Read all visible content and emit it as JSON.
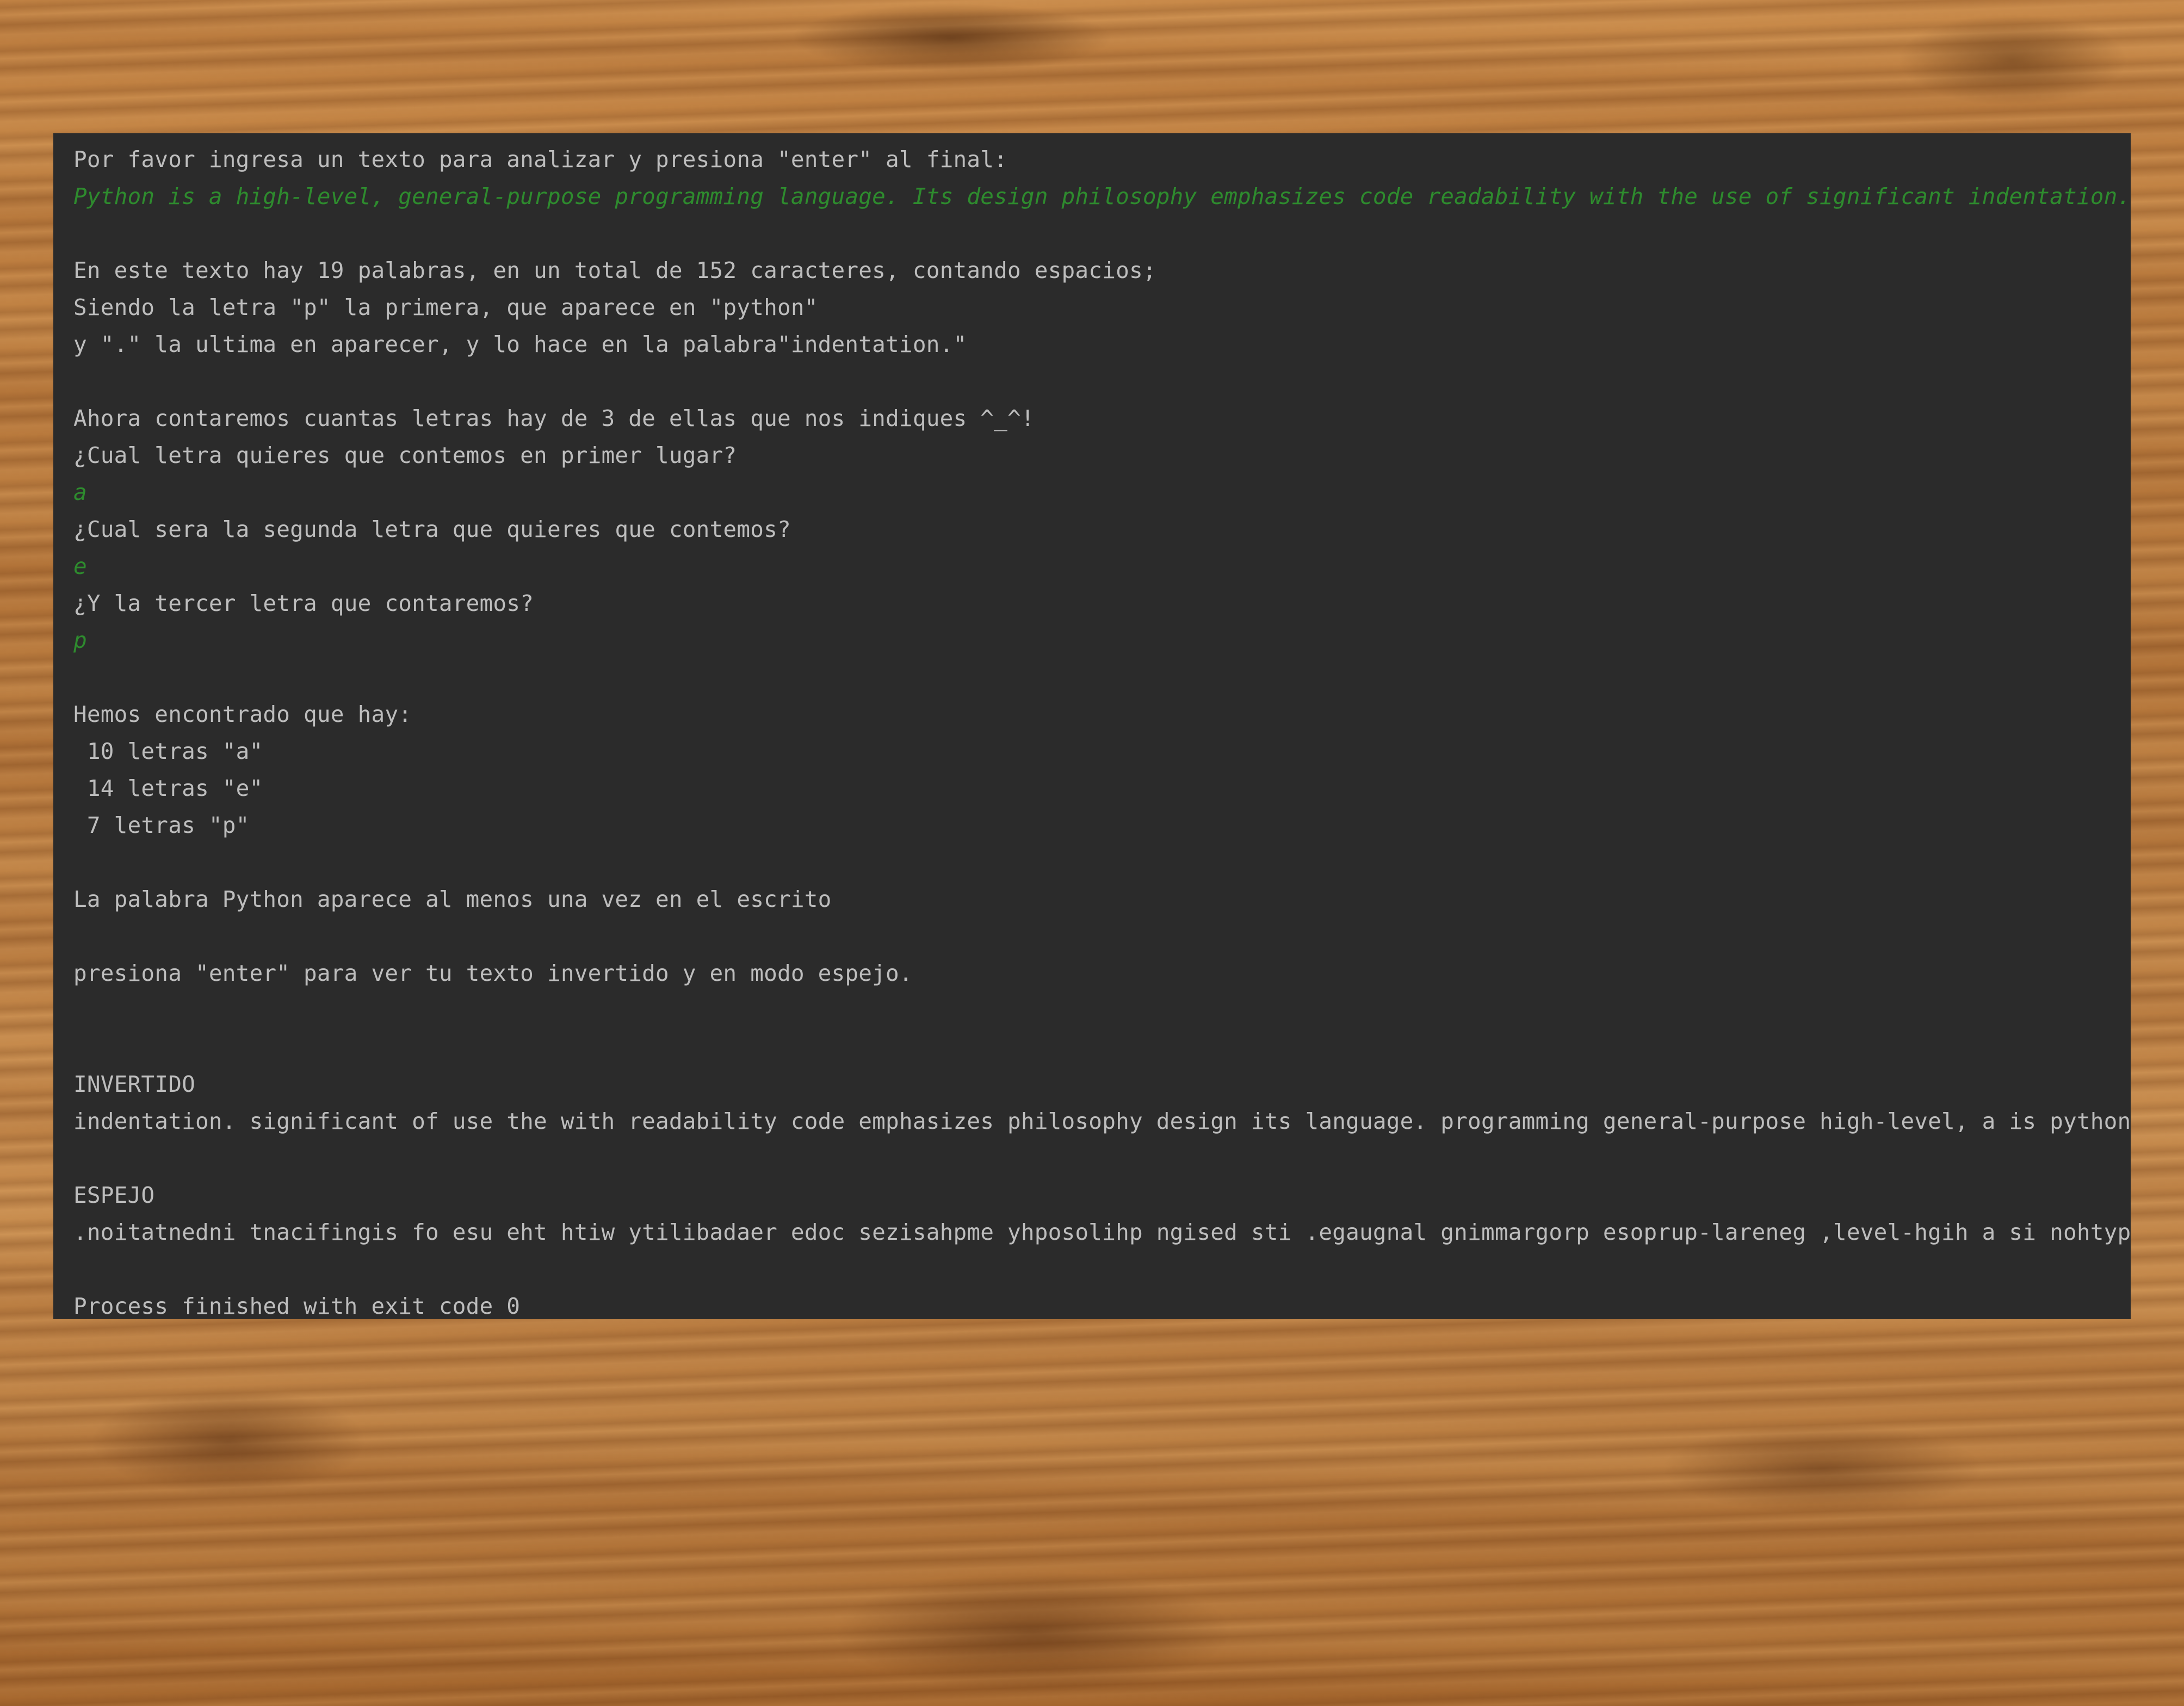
{
  "colors": {
    "console_bg": "#2b2b2b",
    "output_text": "#bdbdbd",
    "user_input_text": "#2e8b2e",
    "background_wood": "#b97a3e"
  },
  "console": {
    "prompt_intro": "Por favor ingresa un texto para analizar y presiona \"enter\" al final:",
    "input_text": "Python is a high-level, general-purpose programming language. Its design philosophy emphasizes code readability with the use of significant indentation.",
    "summary_words": "En este texto hay 19 palabras, en un total de 152 caracteres, contando espacios;",
    "summary_first": "Siendo la letra \"p\" la primera, que aparece en \"python\"",
    "summary_last": "y \".\" la ultima en aparecer, y lo hace en la palabra\"indentation.\"",
    "count_intro": "Ahora contaremos cuantas letras hay de 3 de ellas que nos indiques ^_^!",
    "ask_first": "¿Cual letra quieres que contemos en primer lugar?",
    "answer_first": "a",
    "ask_second": "¿Cual sera la segunda letra que quieres que contemos?",
    "answer_second": "e",
    "ask_third": "¿Y la tercer letra que contaremos?",
    "answer_third": "p",
    "found_header": "Hemos encontrado que hay:",
    "count_a": " 10 letras \"a\"",
    "count_e": " 14 letras \"e\"",
    "count_p": " 7 letras \"p\"",
    "python_found": "La palabra Python aparece al menos una vez en el escrito",
    "press_enter": "presiona \"enter\" para ver tu texto invertido y en modo espejo.",
    "inverted_header": "INVERTIDO",
    "inverted_text": "indentation. significant of use the with readability code emphasizes philosophy design its language. programming general-purpose high-level, a is python",
    "mirror_header": "ESPEJO",
    "mirror_text": ".noitatnedni tnacifingis fo esu eht htiw ytilibadaer edoc sezisahpme yhposolihp ngised sti .egaugnal gnimmargorp esoprup-lareneg ,level-hgih a si nohtyp",
    "exit_message": "Process finished with exit code 0"
  }
}
